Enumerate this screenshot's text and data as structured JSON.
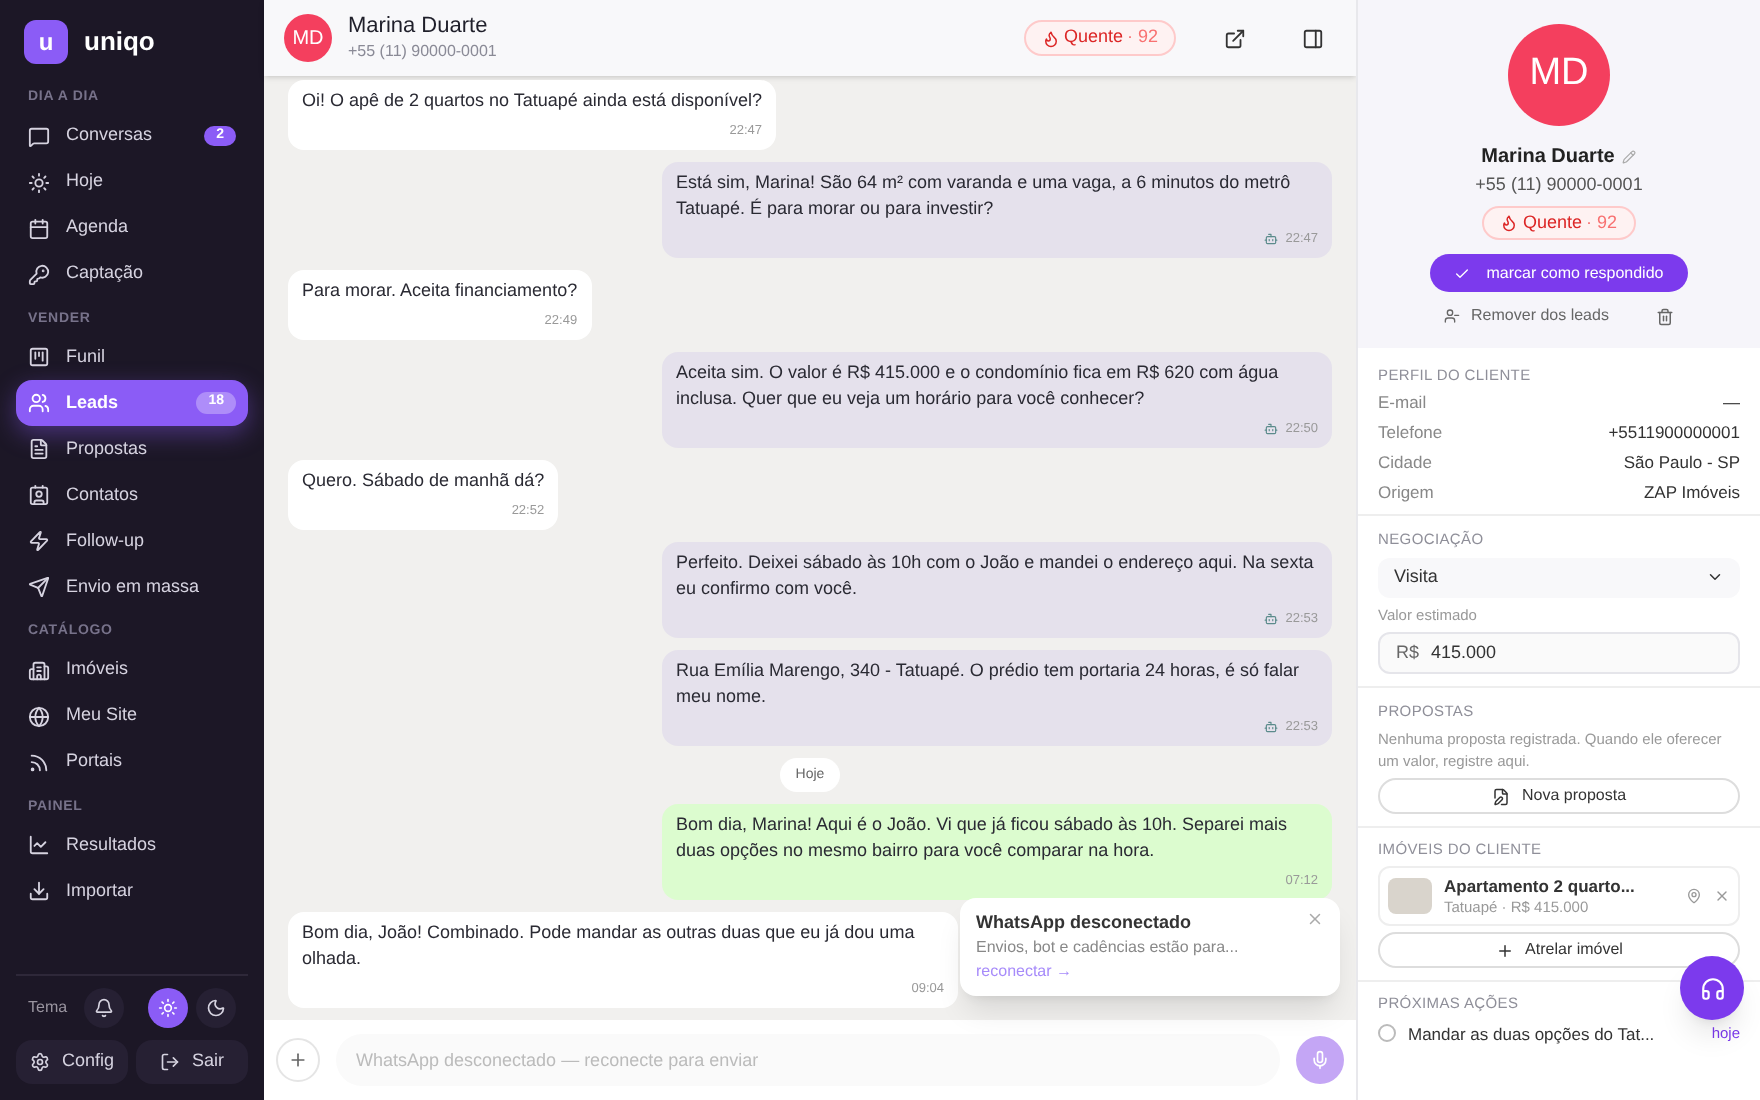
{
  "brand": {
    "name": "uniqo",
    "logo_letter": "u"
  },
  "sidebar": {
    "sections": [
      {
        "title": "DIA A DIA",
        "items": [
          {
            "label": "Conversas",
            "badge": "2",
            "selected": false
          },
          {
            "label": "Hoje",
            "selected": false
          },
          {
            "label": "Agenda",
            "selected": false
          },
          {
            "label": "Captação",
            "selected": false
          }
        ]
      },
      {
        "title": "VENDER",
        "items": [
          {
            "label": "Funil",
            "selected": false
          },
          {
            "label": "Leads",
            "badge": "18",
            "selected": true
          },
          {
            "label": "Propostas",
            "selected": false
          },
          {
            "label": "Contatos",
            "selected": false
          },
          {
            "label": "Follow-up",
            "selected": false
          },
          {
            "label": "Envio em massa",
            "selected": false
          }
        ]
      },
      {
        "title": "CATÁLOGO",
        "items": [
          {
            "label": "Imóveis",
            "selected": false
          },
          {
            "label": "Meu Site",
            "selected": false
          },
          {
            "label": "Portais",
            "selected": false
          }
        ]
      },
      {
        "title": "PAINEL",
        "items": [
          {
            "label": "Resultados",
            "selected": false
          },
          {
            "label": "Importar",
            "selected": false
          }
        ]
      }
    ],
    "theme_label": "Tema",
    "theme_options": [
      {
        "kind": "light",
        "selected": true
      },
      {
        "kind": "dark",
        "selected": false
      }
    ],
    "config": "Config",
    "logout": "Sair"
  },
  "chat": {
    "contact": {
      "initials": "MD",
      "name": "Marina Duarte",
      "phone": "+55 (11) 90000-0001"
    },
    "temperature": {
      "label": "Quente",
      "score": "· 92"
    },
    "messages": [
      {
        "kind": "in",
        "text": "Oi! O apê de 2 quartos no Tatuapé ainda está disponível?",
        "time": "22:47"
      },
      {
        "kind": "bot",
        "text": "Está sim, Marina! São 64 m² com varanda e uma vaga, a 6 minutos do metrô Tatuapé. É para morar ou para investir?",
        "time": "22:47"
      },
      {
        "kind": "in",
        "text": "Para morar. Aceita financiamento?",
        "time": "22:49"
      },
      {
        "kind": "bot",
        "text": "Aceita sim. O valor é R$ 415.000 e o condomínio fica em R$ 620 com água inclusa. Quer que eu veja um horário para você conhecer?",
        "time": "22:50"
      },
      {
        "kind": "in",
        "text": "Quero. Sábado de manhã dá?",
        "time": "22:52"
      },
      {
        "kind": "bot",
        "text": "Perfeito. Deixei sábado às 10h com o João e mandei o endereço aqui. Na sexta eu confirmo com você.",
        "time": "22:53"
      },
      {
        "kind": "bot",
        "text": "Rua Emília Marengo, 340 - Tatuapé. O prédio tem portaria 24 horas, é só falar meu nome.",
        "time": "22:53"
      },
      {
        "kind": "date",
        "text": "Hoje"
      },
      {
        "kind": "agent",
        "text": "Bom dia, Marina! Aqui é o João. Vi que já ficou sábado às 10h. Separei mais duas opções no mesmo bairro para você comparar na hora.",
        "time": "07:12"
      },
      {
        "kind": "in",
        "text": "Bom dia, João! Combinado. Pode mandar as outras duas que eu já dou uma olhada.",
        "time": "09:04"
      }
    ],
    "composer": {
      "placeholder": "WhatsApp desconectado — reconecte para enviar"
    }
  },
  "toast": {
    "title": "WhatsApp desconectado",
    "text": "Envios, bot e cadências estão para...",
    "link": "reconectar →"
  },
  "profile": {
    "initials": "MD",
    "name": "Marina Duarte",
    "phone": "+55 (11) 90000-0001",
    "temperature": {
      "label": "Quente",
      "score": "· 92"
    },
    "mark_button": "marcar como respondido",
    "remove": "Remover dos leads",
    "section_title": "PERFIL DO CLIENTE",
    "fields": [
      {
        "label": "E-mail",
        "value": "—"
      },
      {
        "label": "Telefone",
        "value": "+5511900000001"
      },
      {
        "label": "Cidade",
        "value": "São Paulo - SP"
      },
      {
        "label": "Origem",
        "value": "ZAP Imóveis"
      }
    ]
  },
  "negotiation": {
    "title": "NEGOCIAÇÃO",
    "stage": "Visita",
    "value_label": "Valor estimado",
    "currency": "R$",
    "value": "415.000"
  },
  "proposals": {
    "title": "PROPOSTAS",
    "empty": "Nenhuma proposta registrada. Quando ele oferecer um valor, registre aqui.",
    "button": "Nova proposta"
  },
  "properties": {
    "title": "IMÓVEIS DO CLIENTE",
    "items": [
      {
        "name": "Apartamento 2 quarto...",
        "detail": "Tatuapé · R$ 415.000"
      }
    ],
    "button": "Atrelar imóvel"
  },
  "next_actions": {
    "title": "PRÓXIMAS AÇÕES",
    "items": [
      {
        "text": "Mandar as duas opções do Tat...",
        "when": "hoje",
        "checked": false
      }
    ]
  }
}
